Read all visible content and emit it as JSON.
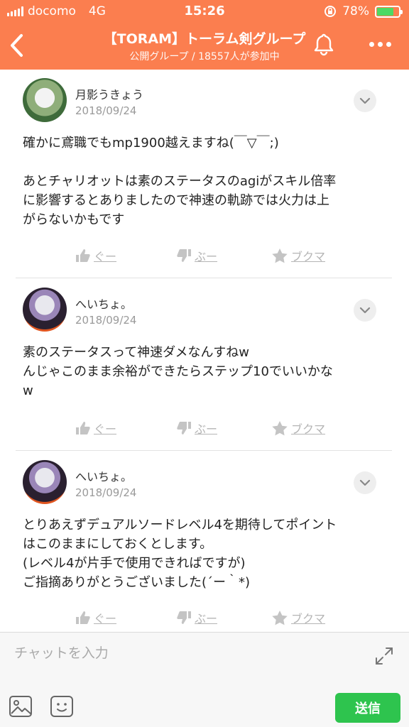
{
  "status_bar": {
    "carrier": "docomo",
    "network": "4G",
    "time": "15:26",
    "battery": "78%",
    "battery_level": 0.78
  },
  "header": {
    "title": "【TORAM】トーラム剣グループ",
    "subtitle": "公開グループ / 18557人が参加中"
  },
  "messages": [
    {
      "user": "月影うきょう",
      "date": "2018/09/24",
      "text": "確かに鳶職でもmp1900越えますね(￣▽￣;)\n\nあとチャリオットは素のステータスのagiがスキル倍率\nに影響するとありましたので神速の軌跡では火力は上\nがらないかもです"
    },
    {
      "user": "へいちょ。",
      "date": "2018/09/24",
      "text": "素のステータスって神速ダメなんすねw\nんじゃこのまま余裕ができたらステップ10でいいかな\nw"
    },
    {
      "user": "へいちょ。",
      "date": "2018/09/24",
      "text": "とりあえずデュアルソードレベル4を期待してポイント\nはこのままにしておくとします。\n(レベル4が片手で使用できればですが)\nご指摘ありがとうございました(´ー｀*)"
    }
  ],
  "actions": {
    "like": "ぐー",
    "dislike": "ぶー",
    "bookmark": "ブクマ"
  },
  "composer": {
    "placeholder": "チャットを入力",
    "send": "送信"
  },
  "colors": {
    "header_bg": "#fb7e4f",
    "send_bg": "#2ec44e"
  }
}
